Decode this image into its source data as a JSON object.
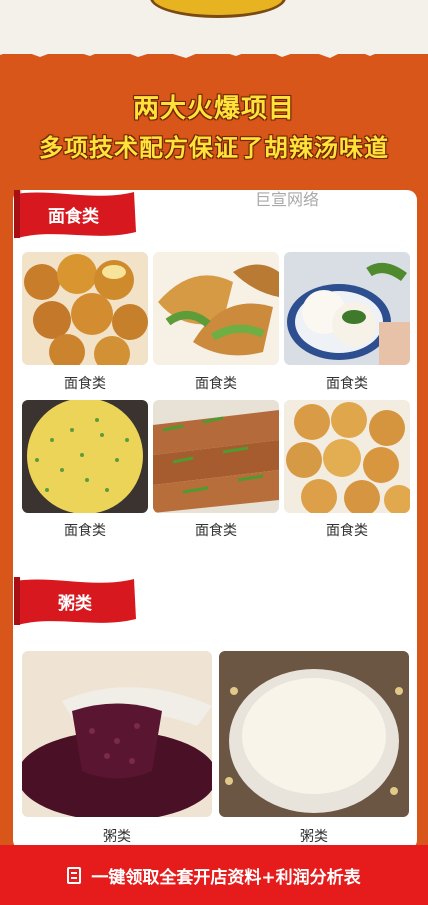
{
  "headline": {
    "line1": "两大火爆项目",
    "line2": "多项技术配方保证了胡辣汤味道"
  },
  "watermark": "巨宣网络",
  "sections": {
    "noodle": {
      "title": "面食类",
      "items": [
        {
          "label": "面食类",
          "icon": "fried-dough-balls-image"
        },
        {
          "label": "面食类",
          "icon": "vegetable-pies-image"
        },
        {
          "label": "面食类",
          "icon": "steamed-buns-image"
        },
        {
          "label": "面食类",
          "icon": "egg-pancake-image"
        },
        {
          "label": "面食类",
          "icon": "scallion-flatbread-image"
        },
        {
          "label": "面食类",
          "icon": "sesame-balls-image"
        }
      ]
    },
    "porridge": {
      "title": "粥类",
      "items": [
        {
          "label": "粥类",
          "icon": "red-bean-porridge-image"
        },
        {
          "label": "粥类",
          "icon": "soy-milk-image"
        }
      ]
    }
  },
  "cta": {
    "label": "一键领取全套开店资料+利润分析表",
    "icon": "document-icon"
  },
  "colors": {
    "background": "#d8561a",
    "headline": "#ffe23a",
    "ribbon": "#d7191f",
    "cta": "#e61b1b"
  }
}
